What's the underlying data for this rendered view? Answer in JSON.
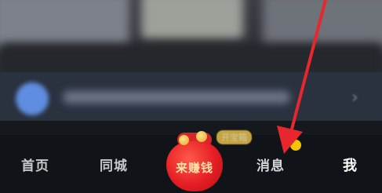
{
  "tab_bar": {
    "tabs": [
      {
        "label": "首页"
      },
      {
        "label": "同城"
      },
      {
        "label": "消息"
      },
      {
        "label": "我"
      }
    ],
    "center_button": {
      "label": "来赚钱"
    },
    "badge": "开宝箱"
  },
  "colors": {
    "arrow": "#e8262d",
    "bag": "#e51e24",
    "badge": "#f2c94c",
    "dot": "#f5c400"
  }
}
